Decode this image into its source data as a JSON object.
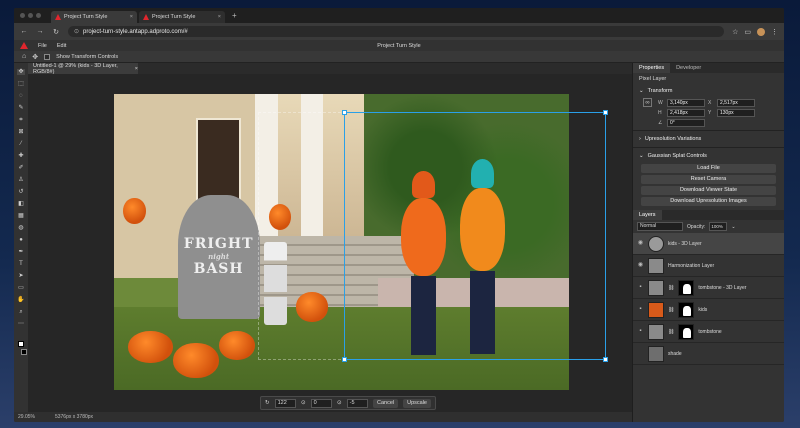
{
  "browser": {
    "tabs": [
      {
        "label": "Project Turn Style"
      },
      {
        "label": "Project Turn Style"
      }
    ],
    "new_tab": "+",
    "url": "project-turn-style.antapp.adproto.com/#"
  },
  "app": {
    "title": "Project Turn Style",
    "menu": [
      {
        "label": "File"
      },
      {
        "label": "Edit"
      }
    ],
    "options": {
      "show_transform_label": "Show Transform Controls"
    }
  },
  "document": {
    "tab_label": "Untitled-1 @ 29% (kids - 3D Layer, RGB/8#)",
    "tab_close": "×",
    "tombstone": {
      "line1": "FRIGHT",
      "line2": "night",
      "line3": "BASH"
    }
  },
  "context_bar": {
    "rotate_value": "122",
    "offset_value": "0",
    "depth_value": "-5",
    "cancel_label": "Cancel",
    "upscale_label": "Upscale"
  },
  "status": {
    "zoom": "29.05%",
    "dims": "5376px x 3780px"
  },
  "properties": {
    "tabs": [
      {
        "label": "Properties"
      },
      {
        "label": "Developer"
      }
    ],
    "section": "Pixel Layer",
    "transform_title": "Transform",
    "w_label": "W",
    "w_value": "3,140px",
    "x_label": "X",
    "x_value": "2,517px",
    "h_label": "H",
    "h_value": "2,418px",
    "y_label": "Y",
    "y_value": "130px",
    "angle_value": "0°",
    "upres_title": "Upresolution Variations",
    "gaussian_title": "Gaussian Splat Controls",
    "buttons": [
      {
        "label": "Load File"
      },
      {
        "label": "Reset Camera"
      },
      {
        "label": "Download Viewer State"
      },
      {
        "label": "Download Upresolution Images"
      }
    ]
  },
  "layers": {
    "tab_label": "Layers",
    "blend_mode": "Normal",
    "opacity_label": "Opacity:",
    "opacity_value": "100%",
    "items": [
      {
        "name": "kids - 3D Layer"
      },
      {
        "name": "Harmonization Layer"
      },
      {
        "name": "tombstone - 3D Layer"
      },
      {
        "name": "kids"
      },
      {
        "name": "tombstone"
      },
      {
        "name": "shade"
      }
    ]
  },
  "colors": {
    "accent": "#e0262d",
    "selection": "#2aa0e8"
  },
  "icons": {
    "back": "arrow-left-icon",
    "forward": "arrow-right-icon",
    "reload": "reload-icon",
    "star": "star-icon",
    "move": "move-icon",
    "eye": "eye-icon",
    "link": "link-icon"
  }
}
